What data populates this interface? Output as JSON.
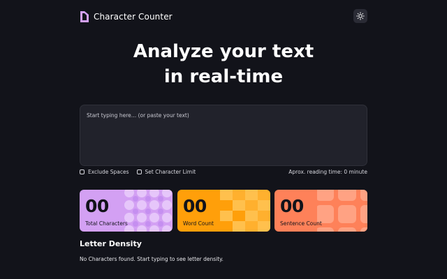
{
  "header": {
    "app_title": "Character Counter",
    "logo_icon": "document-half-icon",
    "theme_toggle_icon": "sun-icon"
  },
  "hero": {
    "line1": "Analyze your text",
    "line2": "in real-time"
  },
  "editor": {
    "placeholder": "Start typing here… (or paste your text)",
    "value": ""
  },
  "options": {
    "exclude_spaces_label": "Exclude Spaces",
    "exclude_spaces_checked": false,
    "char_limit_label": "Set Character Limit",
    "char_limit_checked": false,
    "reading_time": "Aprox. reading time: 0 minute"
  },
  "stats": [
    {
      "value": "00",
      "label": "Total Characters",
      "color": "#d3a0f3"
    },
    {
      "value": "00",
      "label": "Word Count",
      "color": "#ff9f0a"
    },
    {
      "value": "00",
      "label": "Sentence Count",
      "color": "#fe8159"
    }
  ],
  "density": {
    "title": "Letter Density",
    "empty_message": "No Characters found. Start typing to see letter density."
  },
  "colors": {
    "background": "#12131a",
    "surface": "#21222b",
    "accent_purple": "#d3a0f3"
  }
}
